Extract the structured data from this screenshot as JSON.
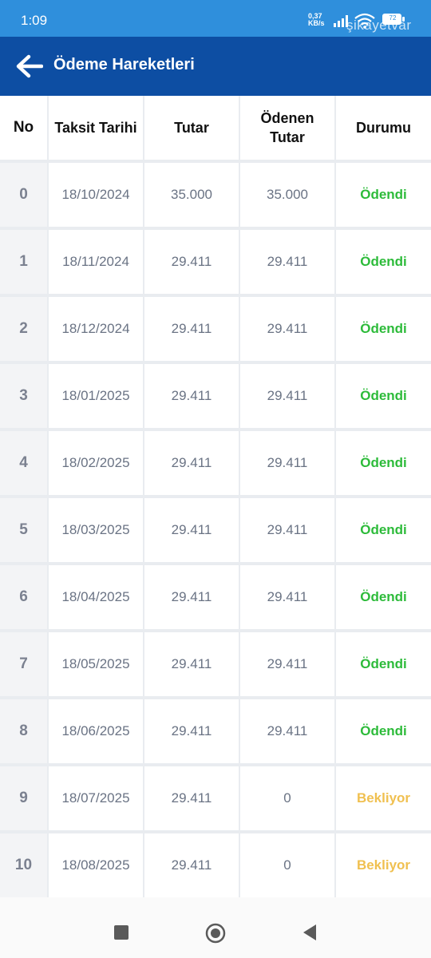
{
  "status_bar": {
    "time": "1:09",
    "net_speed_value": "0,37",
    "net_speed_unit": "KB/s",
    "battery": "72",
    "watermark": "şikayetvar"
  },
  "app_bar": {
    "title": "Ödeme Hareketleri",
    "back_icon": "arrow-left-icon"
  },
  "table": {
    "headers": [
      "No",
      "Taksit Tarihi",
      "Tutar",
      "Ödenen Tutar",
      "Durumu"
    ],
    "rows": [
      {
        "no": "0",
        "date": "18/10/2024",
        "amount": "35.000",
        "paid": "35.000",
        "status": "Ödendi",
        "status_type": "paid"
      },
      {
        "no": "1",
        "date": "18/11/2024",
        "amount": "29.411",
        "paid": "29.411",
        "status": "Ödendi",
        "status_type": "paid"
      },
      {
        "no": "2",
        "date": "18/12/2024",
        "amount": "29.411",
        "paid": "29.411",
        "status": "Ödendi",
        "status_type": "paid"
      },
      {
        "no": "3",
        "date": "18/01/2025",
        "amount": "29.411",
        "paid": "29.411",
        "status": "Ödendi",
        "status_type": "paid"
      },
      {
        "no": "4",
        "date": "18/02/2025",
        "amount": "29.411",
        "paid": "29.411",
        "status": "Ödendi",
        "status_type": "paid"
      },
      {
        "no": "5",
        "date": "18/03/2025",
        "amount": "29.411",
        "paid": "29.411",
        "status": "Ödendi",
        "status_type": "paid"
      },
      {
        "no": "6",
        "date": "18/04/2025",
        "amount": "29.411",
        "paid": "29.411",
        "status": "Ödendi",
        "status_type": "paid"
      },
      {
        "no": "7",
        "date": "18/05/2025",
        "amount": "29.411",
        "paid": "29.411",
        "status": "Ödendi",
        "status_type": "paid"
      },
      {
        "no": "8",
        "date": "18/06/2025",
        "amount": "29.411",
        "paid": "29.411",
        "status": "Ödendi",
        "status_type": "paid"
      },
      {
        "no": "9",
        "date": "18/07/2025",
        "amount": "29.411",
        "paid": "0",
        "status": "Bekliyor",
        "status_type": "pending"
      },
      {
        "no": "10",
        "date": "18/08/2025",
        "amount": "29.411",
        "paid": "0",
        "status": "Bekliyor",
        "status_type": "pending"
      }
    ]
  },
  "nav_bar": {
    "icons": [
      "recent-apps-icon",
      "home-icon",
      "back-icon"
    ]
  },
  "colors": {
    "status_bar": "#2f8fdc",
    "app_bar": "#0d4ea3",
    "paid": "#2dbb3a",
    "pending": "#f0c050"
  }
}
